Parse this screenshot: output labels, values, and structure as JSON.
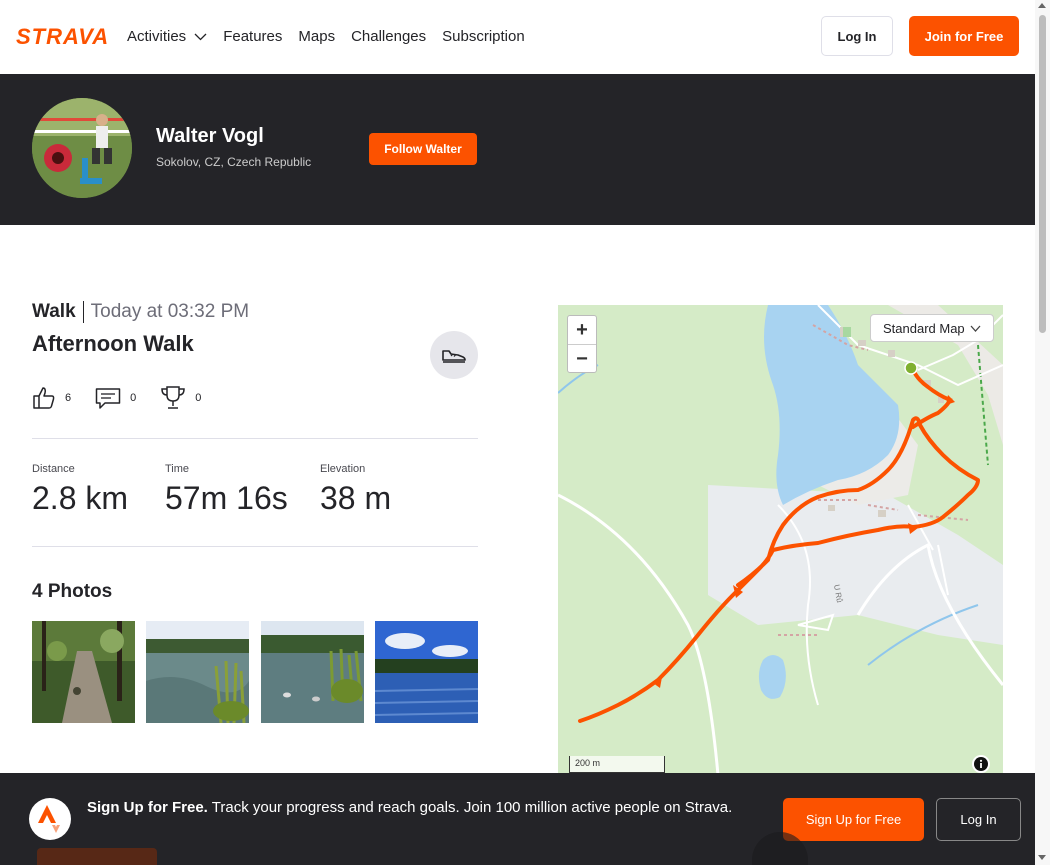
{
  "brand": {
    "name": "STRAVA",
    "color": "#fc5200"
  },
  "nav": {
    "items": [
      {
        "label": "Activities",
        "has_dropdown": true
      },
      {
        "label": "Features"
      },
      {
        "label": "Maps"
      },
      {
        "label": "Challenges"
      },
      {
        "label": "Subscription"
      }
    ],
    "login": "Log In",
    "join": "Join for Free"
  },
  "athlete": {
    "name": "Walter Vogl",
    "location": "Sokolov, CZ, Czech Republic",
    "follow": "Follow Walter"
  },
  "activity": {
    "type": "Walk",
    "time": "Today at 03:32 PM",
    "title": "Afternoon Walk",
    "gear_icon": "shoe-icon",
    "kudos": "6",
    "comments": "0",
    "achievements": "0",
    "stats": [
      {
        "label": "Distance",
        "value": "2.8 km"
      },
      {
        "label": "Time",
        "value": "57m 16s"
      },
      {
        "label": "Elevation",
        "value": "38 m"
      }
    ],
    "photos_title": "4 Photos",
    "photos": [
      "forest-path-photo",
      "pond-photo",
      "pond-ducks-photo",
      "pond-sky-photo"
    ]
  },
  "map": {
    "style": "Standard Map",
    "zoom_in": "+",
    "zoom_out": "−",
    "scale": "200 m",
    "route_color": "#fc5200"
  },
  "signup": {
    "bold": "Sign Up for Free.",
    "text": "Track your progress and reach goals. Join 100 million active people on Strava.",
    "signup_btn": "Sign Up for Free",
    "login_btn": "Log In"
  }
}
